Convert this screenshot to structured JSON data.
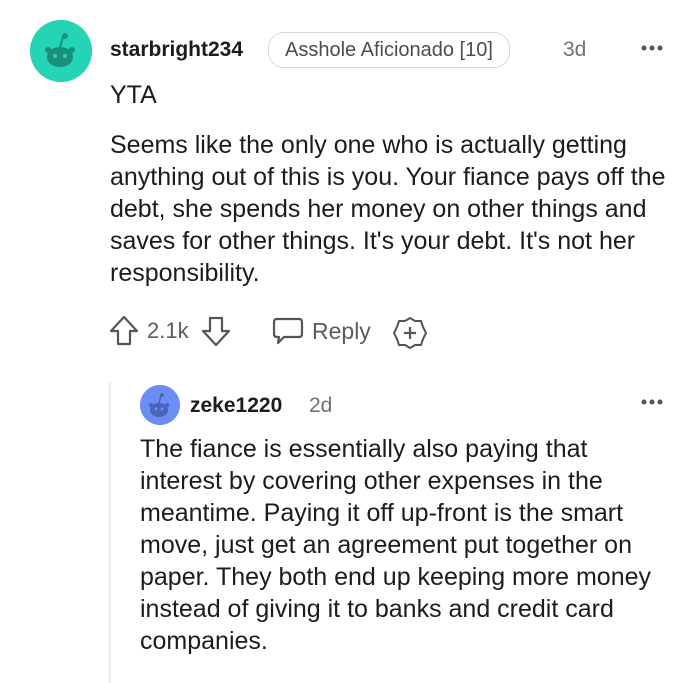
{
  "comment": {
    "username": "starbright234",
    "flair": "Asshole Aficionado [10]",
    "timestamp": "3d",
    "verdict": "YTA",
    "body": "Seems like the only one who is actually getting anything out of this is you. Your fiance pays off the debt, she spends her money on other things and saves for other things. It's your debt. It's not her responsibility.",
    "vote_count": "2.1k",
    "reply_label": "Reply",
    "avatar_color": "#24d4b4"
  },
  "reply": {
    "username": "zeke1220",
    "timestamp": "2d",
    "body": "The fiance is essentially also paying that interest by covering other expenses in the meantime. Paying it off up-front is the smart move, just get an agreement put together on paper. They both end up keeping more money instead of giving it to banks and credit card companies.",
    "avatar_color": "#6c8cf6"
  }
}
